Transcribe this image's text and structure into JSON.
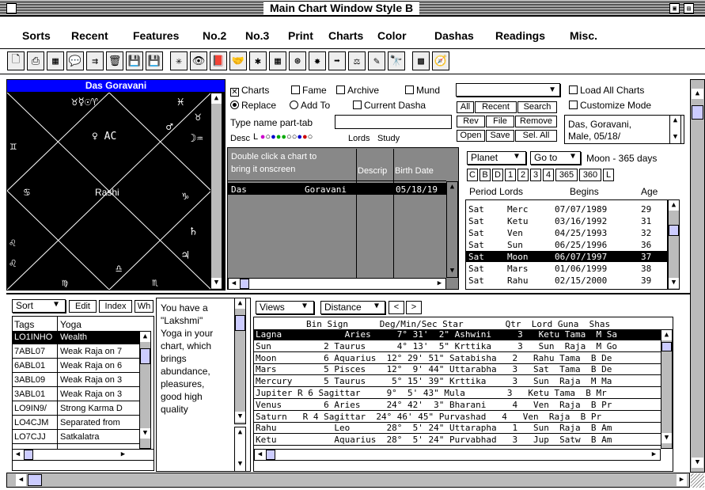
{
  "window": {
    "title": "Main Chart Window Style B"
  },
  "menu": [
    "Sorts",
    "Recent",
    "Features",
    "No.2",
    "No.3",
    "Print",
    "Charts",
    "Color",
    "Dashas",
    "Readings",
    "Misc."
  ],
  "toolbar_icons": [
    "new-document-icon",
    "printer-icon",
    "calculator-icon",
    "speech-bubble-icon",
    "flowchart-icon",
    "trash-icon",
    "save-icon",
    "save-as-icon",
    "wheel-chart-icon",
    "eye-icon",
    "book-icon",
    "handshake-icon",
    "grid-chart-icon",
    "table-icon",
    "circle-chart-icon",
    "sun-icon",
    "export-icon",
    "scales-icon",
    "pencil-icon",
    "binoculars-icon",
    "grid-dots-icon",
    "compass-icon"
  ],
  "chart": {
    "header": "Das Goravani",
    "center_label": "Rashi",
    "house_glyphs": {
      "h1": "♉☿☉♈",
      "h2": "♓",
      "h3": "♉",
      "h4": "♂",
      "h5": "☽♒",
      "h6": "♄",
      "h7": "♃",
      "h8": "♑",
      "h9": "♎",
      "h10": "♍",
      "h11": "♏",
      "h12": "♌",
      "h_left1": "♊",
      "h_left2": "♋",
      "h_left3": "♌",
      "h_left4": "♍"
    },
    "planets_center": "♀  AC",
    "left_signs": [
      "♊",
      "♋",
      "♌",
      "♍"
    ],
    "bottom_signs": [
      "♍",
      "♎",
      "♏"
    ],
    "right_signs": [
      "♓",
      "♉",
      "♐",
      "♑"
    ]
  },
  "options": {
    "charts": "Charts",
    "fame": "Fame",
    "archive": "Archive",
    "mund": "Mund",
    "replace": "Replace",
    "add_to": "Add To",
    "current_dasha": "Current Dasha",
    "type_name": "Type name part-tab",
    "desc": "Desc",
    "lords": "Lords",
    "study": "Study",
    "load_all": "Load All Charts",
    "customize": "Customize Mode"
  },
  "buttons": {
    "all": "All",
    "recent": "Recent",
    "search": "Search",
    "rev": "Rev",
    "file": "File",
    "remove": "Remove",
    "open": "Open",
    "save": "Save",
    "sel_all": "Sel. All"
  },
  "info_box": [
    "Das, Goravani,",
    "Male, 05/18/"
  ],
  "chart_list": {
    "hint": [
      "Double click a chart to",
      "bring it onscreen"
    ],
    "headers": [
      "Descrip",
      "Birth Date"
    ],
    "rows": [
      {
        "last": "Das",
        "first": "Goravani",
        "date": "05/18/19"
      }
    ]
  },
  "dasha": {
    "planet": "Planet",
    "goto": "Go to",
    "moon_label": "Moon - 365 days",
    "tabs": [
      "C",
      "B",
      "D",
      "1",
      "2",
      "3",
      "4",
      "365",
      "360",
      "L"
    ],
    "headers": [
      "Period Lords",
      "Begins",
      "Age"
    ],
    "rows": [
      [
        "Sat",
        "Merc",
        "07/07/1989",
        "29"
      ],
      [
        "Sat",
        "Ketu",
        "03/16/1992",
        "31"
      ],
      [
        "Sat",
        "Ven",
        "04/25/1993",
        "32"
      ],
      [
        "Sat",
        "Sun",
        "06/25/1996",
        "36"
      ],
      [
        "Sat",
        "Moon",
        "06/07/1997",
        "37"
      ],
      [
        "Sat",
        "Mars",
        "01/06/1999",
        "38"
      ],
      [
        "Sat",
        "Rahu",
        "02/15/2000",
        "39"
      ]
    ],
    "selected": 4
  },
  "yoga": {
    "sort": "Sort",
    "edit": "Edit",
    "index": "Index",
    "wh": "Wh",
    "headers": [
      "Tags",
      "Yoga"
    ],
    "rows": [
      [
        "LO1INHO",
        "Wealth"
      ],
      [
        "7ABL07",
        "Weak Raja on 7"
      ],
      [
        "6ABL01",
        "Weak Raja on 6"
      ],
      [
        "3ABL09",
        "Weak Raja on 3"
      ],
      [
        "3ABL01",
        "Weak Raja on 3"
      ],
      [
        "LO9IN9/",
        "Strong Karma D"
      ],
      [
        "LO4CJM",
        "Separated from"
      ],
      [
        "LO7CJJ",
        "Satkalatra"
      ]
    ],
    "description": [
      "You have a",
      "\"Lakshmi\"",
      "Yoga in your",
      "chart, which",
      "brings",
      "abundance,",
      "pleasures,",
      "good high",
      "quality"
    ]
  },
  "planets": {
    "views": "Views",
    "distance": "Distance",
    "headers": "Bin Sign      Deg/Min/Sec Star        Qtr  Lord Guna  Shas",
    "rows": [
      "Lagna            Aries     7° 31'  2\" Ashwini     3   Ketu Tama  M Sa",
      "Sun          2 Taurus      4° 13'  5\" Krttika     3   Sun  Raja  M Go",
      "Moon         6 Aquarius  12° 29' 51\" Satabisha   2   Rahu Tama  B De",
      "Mars         5 Pisces    12°  9' 44\" Uttarabha   3   Sat  Tama  B De",
      "Mercury      5 Taurus     5° 15' 39\" Krttika     3   Sun  Raja  M Ma",
      "Jupiter R 6 Sagittar     9°  5' 43\" Mula        3   Ketu Tama  B Mr",
      "Venus        6 Aries     24° 42'  3\" Bharani     4   Ven  Raja  B Pr",
      "Saturn   R 4 Sagittar  24° 46' 45\" Purvashad   4   Ven  Raja  B Pr",
      "Rahu           Leo       28°  5' 24\" Uttarapha   1   Sun  Raja  B Am",
      "Ketu           Aquarius  28°  5' 24\" Purvabhad   3   Jup  Satw  B Am"
    ],
    "selected": 0
  }
}
